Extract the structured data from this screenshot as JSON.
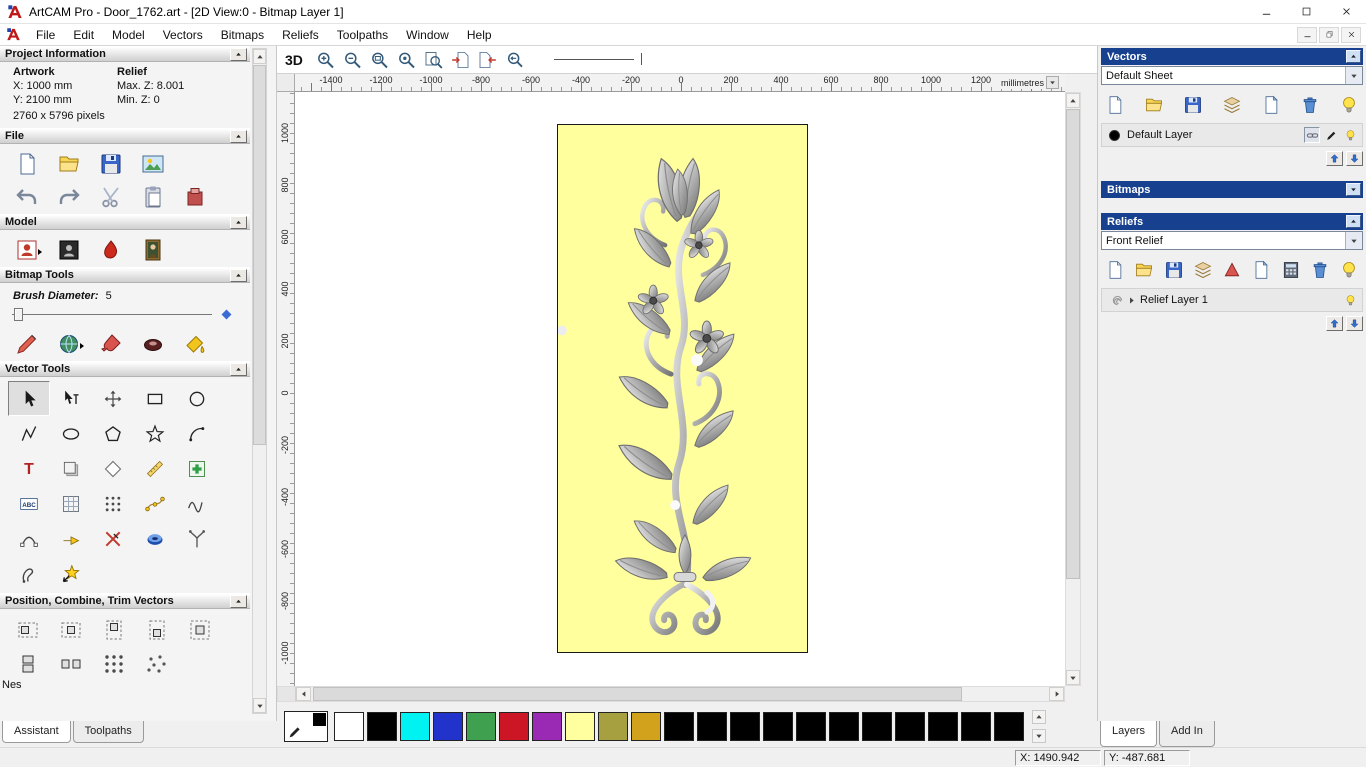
{
  "window": {
    "title": "ArtCAM Pro - Door_1762.art - [2D View:0 - Bitmap Layer 1]"
  },
  "menu": [
    "File",
    "Edit",
    "Model",
    "Vectors",
    "Bitmaps",
    "Reliefs",
    "Toolpaths",
    "Window",
    "Help"
  ],
  "assistant": {
    "project": {
      "title": "Project Information",
      "artwork_header": "Artwork",
      "relief_header": "Relief",
      "artwork_x": "X: 1000 mm",
      "artwork_y": "Y: 2100 mm",
      "relief_max_z": "Max. Z: 8.001",
      "relief_min_z": "Min. Z: 0",
      "pixels": "2760 x 5796 pixels"
    },
    "file": {
      "title": "File",
      "row1": [
        "new-model",
        "open-model",
        "save-model",
        "import-image"
      ],
      "row2": [
        "undo",
        "redo",
        "cut",
        "paste",
        "delete-model"
      ]
    },
    "model": {
      "title": "Model",
      "icons": [
        "edit-model",
        "invert-relief",
        "sculpt",
        "texture-relief"
      ]
    },
    "bitmap_tools": {
      "title": "Bitmap Tools",
      "brush_label": "Brush Diameter:",
      "brush_value": "5",
      "icons": [
        "paint-pencil",
        "colour-globe",
        "paint-brush",
        "draw-donut",
        "flood-fill"
      ]
    },
    "vector_tools": {
      "title": "Vector Tools",
      "rows": [
        [
          "select-vectors",
          "node-editing",
          "transform-vectors",
          "create-rectangle",
          "create-circle"
        ],
        [
          "create-polyline",
          "create-ellipse",
          "create-polygon",
          "create-star",
          "create-arc"
        ],
        [
          "create-text",
          "offset-vectors",
          "create-diamond",
          "measure",
          "paste-special"
        ],
        [
          "text-block",
          "grid-snap",
          "block-copy",
          "nesting",
          "fit-curve"
        ],
        [
          "arc-fit",
          "wrap-vectors",
          "trim-vectors",
          "spin-relief",
          "bezier-fork"
        ],
        [
          "loop-curve",
          "star-wizard"
        ]
      ]
    },
    "position_tools": {
      "title": "Position, Combine, Trim Vectors",
      "row1": [
        "align-left",
        "align-center-h",
        "align-top",
        "align-bottom",
        "align-center"
      ],
      "row2": [
        "align-stack",
        "align-spread",
        "block-copy",
        "scatter"
      ],
      "partial_label": "Nes"
    },
    "tabs": [
      "Assistant",
      "Toolpaths"
    ]
  },
  "viewport": {
    "btn_3d": "3D",
    "toolbar_icons": [
      "zoom-in",
      "zoom-out",
      "zoom-box",
      "zoom-objects",
      "zoom-page",
      "snap-left",
      "snap-right",
      "zoom-previous"
    ],
    "ruler_h_labels": [
      "-1400",
      "-1200",
      "-1000",
      "-800",
      "-600",
      "-400",
      "-200",
      "0",
      "200",
      "400",
      "600",
      "800",
      "1000",
      "1200"
    ],
    "units": "millimetres",
    "ruler_v_labels": [
      "1000",
      "800",
      "600",
      "400",
      "200",
      "0",
      "-200",
      "-400",
      "-600",
      "-800",
      "-1000"
    ],
    "artboard_color": "#ffff9e"
  },
  "layers_panel": {
    "header_color": "#17418e",
    "vectors": {
      "title": "Vectors",
      "sheet": "Default Sheet",
      "toolbar": [
        "new-layer",
        "open-layer",
        "save-layer",
        "merge-layers",
        "new-sheet",
        "delete-layer",
        "toggle-all-visibility"
      ],
      "layer_name": "Default Layer"
    },
    "bitmaps": {
      "title": "Bitmaps"
    },
    "reliefs": {
      "title": "Reliefs",
      "combo": "Front Relief",
      "toolbar": [
        "new-layer",
        "open-layer",
        "save-layer",
        "merge-layers",
        "paste-relief",
        "new-sheet",
        "calculate-relief",
        "delete-layer",
        "toggle-all-visibility"
      ],
      "layer_name": "Relief Layer 1"
    },
    "tabs": [
      "Layers",
      "Add In"
    ]
  },
  "palette": {
    "colors": [
      "#ffffff",
      "#000000",
      "#00f2f2",
      "#2233cc",
      "#3fa04f",
      "#cc1626",
      "#9a2ab4",
      "#ffffa0",
      "#a6a040",
      "#d2a21c",
      "#000000",
      "#000000",
      "#000000",
      "#000000",
      "#000000",
      "#000000",
      "#000000",
      "#000000",
      "#000000",
      "#000000",
      "#000000"
    ]
  },
  "status": {
    "x": "X: 1490.942",
    "y": "Y: -487.681"
  }
}
